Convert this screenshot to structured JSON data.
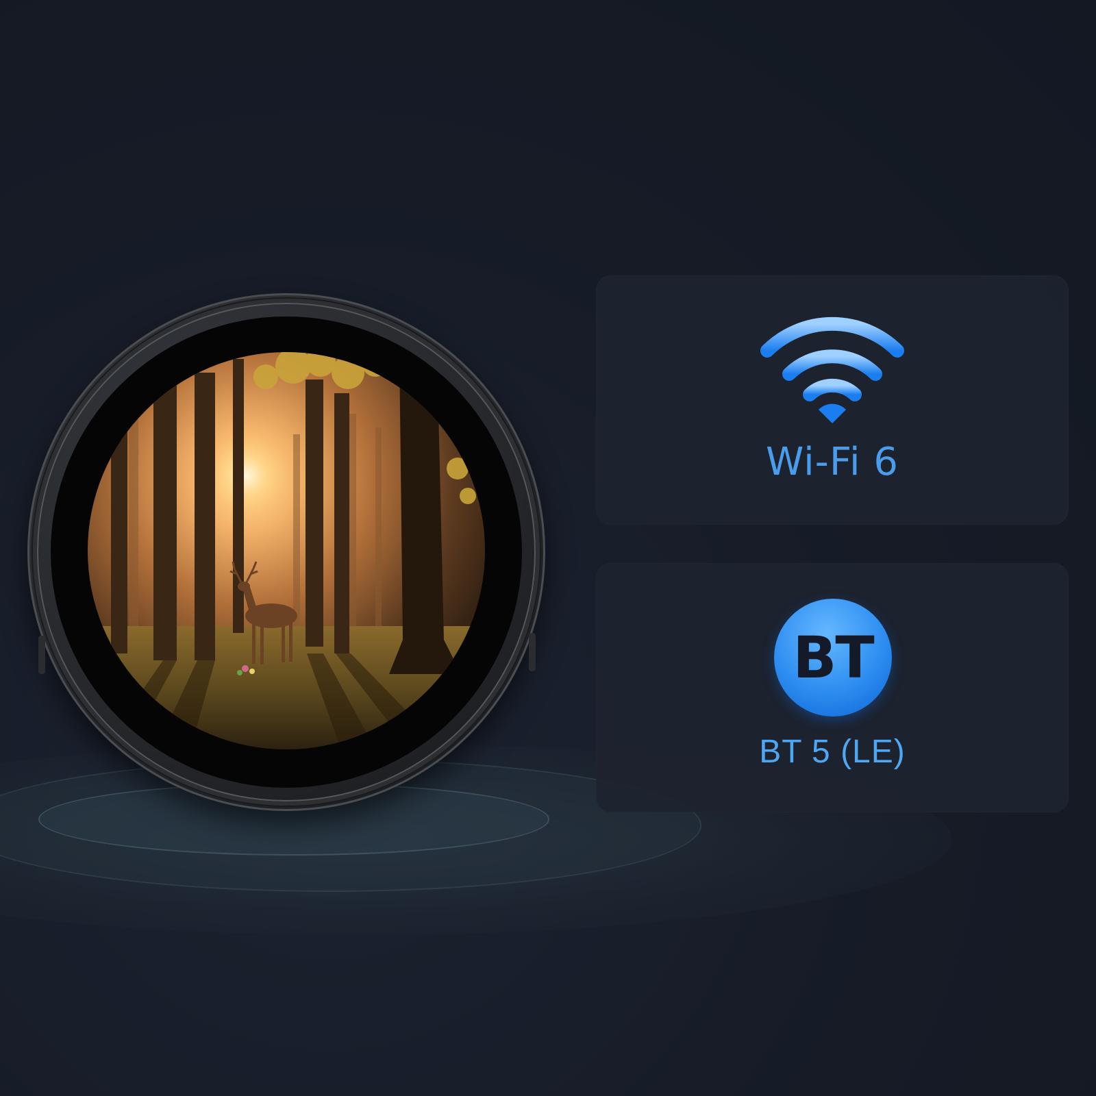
{
  "scene": {
    "colors": {
      "background": "#151a25",
      "card": "#1d232f",
      "accent": "#4a9cec",
      "bt_glyph": "#141a28"
    }
  },
  "device": {
    "screen_icon": "forest-deer-sunset-image"
  },
  "features": [
    {
      "icon": "wifi-icon",
      "label": "Wi-Fi 6"
    },
    {
      "icon": "bt-icon",
      "glyph": "BT",
      "label": "BT 5 (LE)"
    }
  ]
}
